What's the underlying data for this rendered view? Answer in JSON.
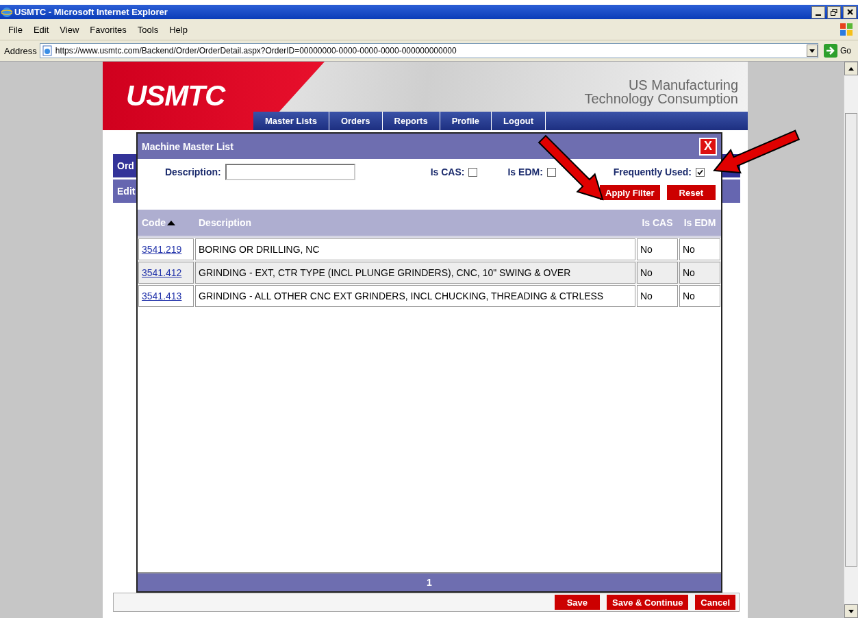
{
  "browser": {
    "title": "USMTC - Microsoft Internet Explorer",
    "menu": [
      "File",
      "Edit",
      "View",
      "Favorites",
      "Tools",
      "Help"
    ],
    "address_label": "Address",
    "url": "https://www.usmtc.com/Backend/Order/OrderDetail.aspx?OrderID=00000000-0000-0000-0000-000000000000",
    "go": "Go"
  },
  "site": {
    "logo": "USMTC",
    "tagline": [
      "US Manufacturing",
      "Technology Consumption"
    ],
    "nav": [
      "Master Lists",
      "Orders",
      "Reports",
      "Profile",
      "Logout"
    ],
    "page_tabs": [
      "Ord",
      "Edit"
    ],
    "buttons": [
      "Save",
      "Save & Continue",
      "Cancel"
    ]
  },
  "dialog": {
    "title": "Machine Master List",
    "close": "X",
    "filters": [
      {
        "kind": "text",
        "label": "Description:"
      },
      {
        "kind": "checkbox",
        "label": "Is CAS:",
        "checked": false
      },
      {
        "kind": "checkbox",
        "label": "Is EDM:",
        "checked": false
      },
      {
        "kind": "checkbox",
        "label": "Frequently Used:",
        "checked": true
      }
    ],
    "buttons": [
      "Apply Filter",
      "Reset"
    ],
    "columns": [
      {
        "label": "Code",
        "sorted": true
      },
      {
        "label": "Description",
        "sorted": false
      },
      {
        "label": "Is CAS",
        "sorted": false
      },
      {
        "label": "Is EDM",
        "sorted": false
      }
    ],
    "rows": [
      [
        "3541.219",
        "BORING OR DRILLING, NC",
        "No",
        "No"
      ],
      [
        "3541.412",
        "GRINDING - EXT, CTR TYPE (INCL PLUNGE GRINDERS), CNC, 10\" SWING & OVER",
        "No",
        "No"
      ],
      [
        "3541.413",
        "GRINDING - ALL OTHER CNC EXT GRINDERS, INCL CHUCKING, THREADING & CTRLESS",
        "No",
        "No"
      ]
    ],
    "pages": [
      "1"
    ]
  }
}
